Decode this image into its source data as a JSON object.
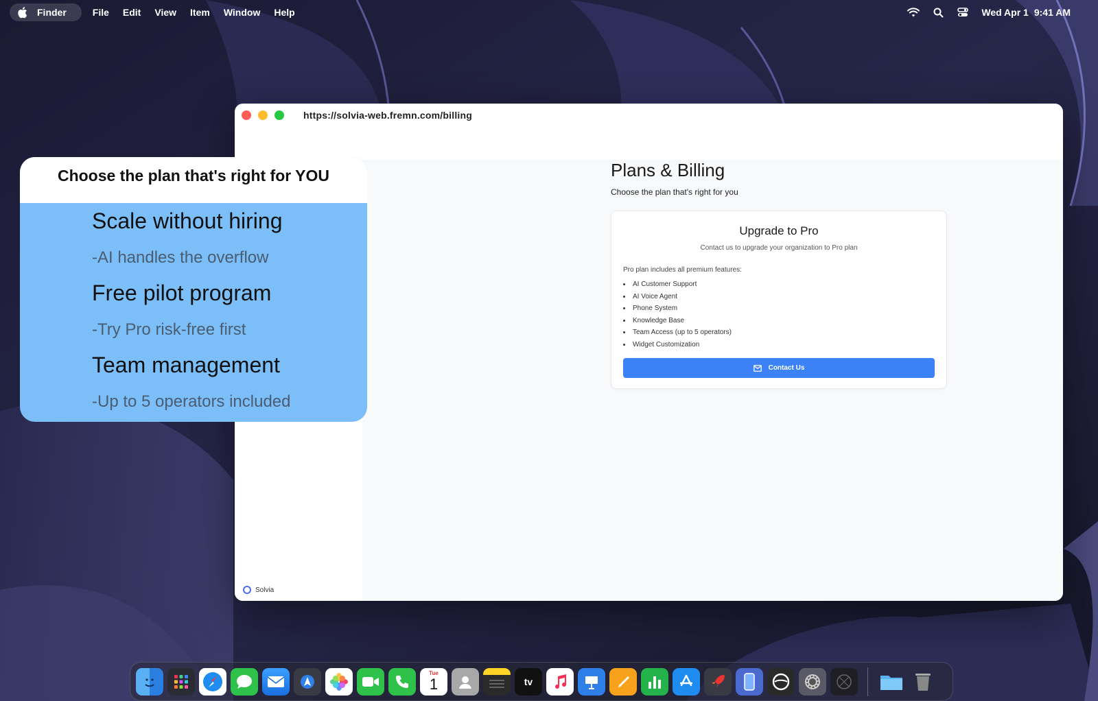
{
  "menubar": {
    "app_name": "Finder",
    "menus": [
      "File",
      "Edit",
      "View",
      "Item",
      "Window",
      "Help"
    ],
    "date": "Wed Apr 1",
    "time": "9:41 AM"
  },
  "browser": {
    "url": "https://solvia-web.fremn.com/billing"
  },
  "sidebar": {
    "brand": "Solvia"
  },
  "page": {
    "title": "Plans & Billing",
    "subtitle": "Choose the plan that's right for you"
  },
  "card": {
    "title": "Upgrade to Pro",
    "subtitle": "Contact us to upgrade your organization to Pro plan",
    "intro": "Pro plan includes all premium features:",
    "features": [
      "AI Customer Support",
      "AI Voice Agent",
      "Phone System",
      "Knowledge Base",
      "Team Access (up to 5 operators)",
      "Widget Customization"
    ],
    "button_label": "Contact Us"
  },
  "promo": {
    "title": "Choose the plan that's right for YOU",
    "items": [
      {
        "heading": "Scale without hiring",
        "sub": "-AI handles the overflow"
      },
      {
        "heading": "Free pilot program",
        "sub": "-Try Pro risk-free first"
      },
      {
        "heading": "Team management",
        "sub": "-Up to 5 operators included"
      }
    ]
  },
  "dock": {
    "calendar_month": "Tue",
    "calendar_day": "1",
    "tv_label": "tv",
    "apps": [
      "finder-icon",
      "launchpad-icon",
      "safari-icon",
      "messages-icon",
      "mail-icon",
      "maps-icon",
      "photos-icon",
      "facetime-icon",
      "phone-icon",
      "calendar-icon",
      "contacts-icon",
      "notes-icon",
      "tv-icon",
      "music-icon",
      "keynote-icon",
      "pages-icon",
      "numbers-icon",
      "app-store-icon",
      "rocket-icon",
      "simulator-icon",
      "browser-icon",
      "system-settings-icon",
      "utility-icon"
    ]
  },
  "colors": {
    "accent": "#3b82f6",
    "promo_bg": "#7bbef8"
  }
}
